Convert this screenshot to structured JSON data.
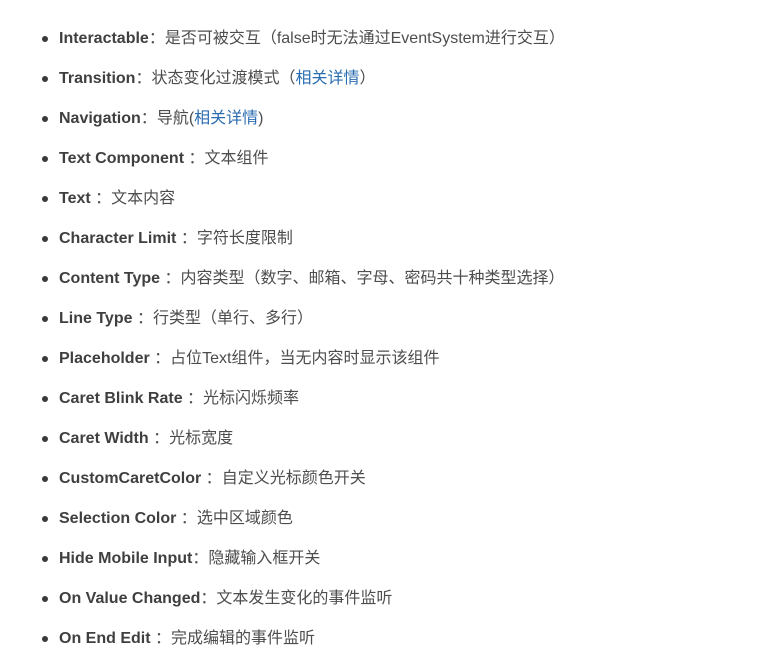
{
  "items": [
    {
      "term": "Interactable",
      "sep": "：",
      "desc": "是否可被交互（false时无法通过EventSystem进行交互）"
    },
    {
      "term": "Transition",
      "sep": "：",
      "desc": "状态变化过渡模式（",
      "link": "相关详情",
      "desc_after": "）"
    },
    {
      "term": "Navigation",
      "sep": "：",
      "desc": "导航(",
      "link": "相关详情",
      "desc_after": ")"
    },
    {
      "term": "Text Component",
      "sep": " ：",
      "desc": "文本组件"
    },
    {
      "term": "Text",
      "sep": " ：",
      "desc": "文本内容"
    },
    {
      "term": "Character Limit",
      "sep": " ：",
      "desc": "字符长度限制"
    },
    {
      "term": "Content Type",
      "sep": " ：",
      "desc": "内容类型（数字、邮箱、字母、密码共十种类型选择）"
    },
    {
      "term": "Line Type",
      "sep": " ：",
      "desc": "行类型（单行、多行）"
    },
    {
      "term": "Placeholder",
      "sep": " ：",
      "desc": "占位Text组件，当无内容时显示该组件"
    },
    {
      "term": "Caret Blink Rate",
      "sep": " ：",
      "desc": "光标闪烁频率"
    },
    {
      "term": "Caret Width",
      "sep": " ：",
      "desc": "光标宽度"
    },
    {
      "term": "CustomCaretColor",
      "sep": " ：",
      "desc": "自定义光标颜色开关"
    },
    {
      "term": "Selection Color",
      "sep": " ：",
      "desc": "选中区域颜色"
    },
    {
      "term": "Hide Mobile Input",
      "sep": "：",
      "desc": "隐藏输入框开关"
    },
    {
      "term": "On Value Changed",
      "sep": "：",
      "desc": "文本发生变化的事件监听"
    },
    {
      "term": "On End Edit",
      "sep": " ：",
      "desc": "完成编辑的事件监听"
    }
  ],
  "colors": {
    "text": "#4d4d4d",
    "term": "#3f3f3f",
    "link": "#2a6cb0"
  }
}
